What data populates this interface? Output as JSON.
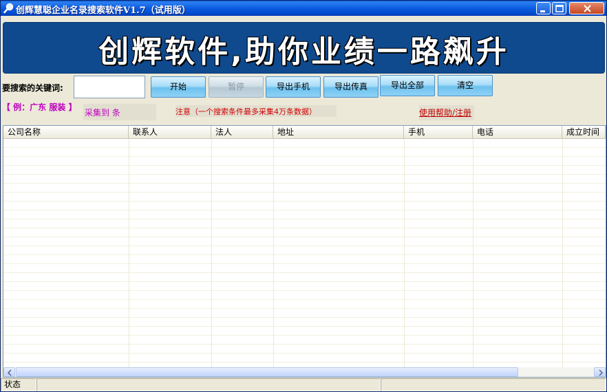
{
  "window": {
    "title": "创辉慧聪企业名录搜索软件V1.7（试用版）"
  },
  "banner": {
    "text": "创辉软件,助你业绩一路飙升"
  },
  "search": {
    "label": "要搜索的关键词:",
    "input_value": "",
    "example": "【 例：广东  服装 】",
    "collected": "采集到   条",
    "notice": "注意（一个搜索条件最多采集4万条数据）",
    "help_link": "使用帮助/注册"
  },
  "buttons": {
    "start": "开始",
    "pause": "暂停",
    "export_phone": "导出手机",
    "export_fax": "导出传真",
    "export_all": "导出全部",
    "clear": "清空"
  },
  "table": {
    "columns": [
      "公司名称",
      "联系人",
      "法人",
      "地址",
      "手机",
      "电话",
      "成立时间"
    ],
    "rows": []
  },
  "status": {
    "label": "状态",
    "message": "",
    "extra": ""
  }
}
